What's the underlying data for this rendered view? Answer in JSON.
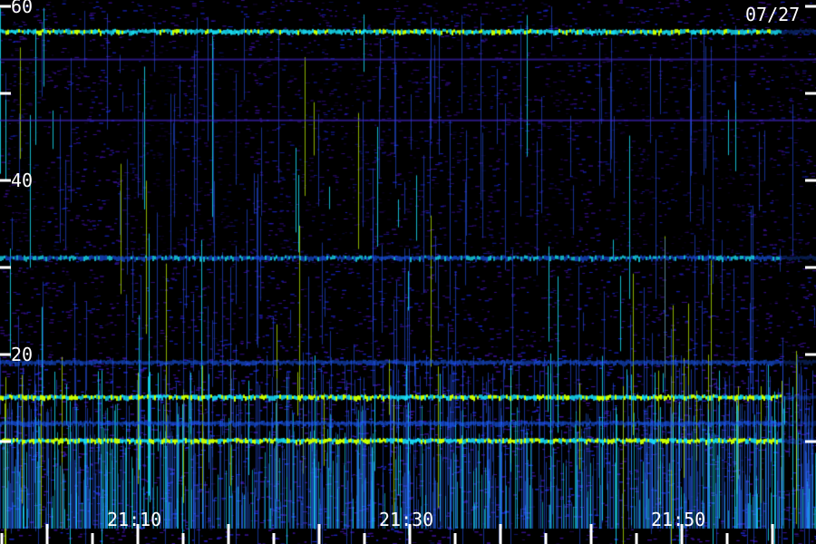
{
  "chart_data": {
    "type": "heatmap",
    "date_label": "07/27",
    "ylim": [
      0,
      60
    ],
    "y_tick_labels": [
      "60",
      "40",
      "20"
    ],
    "y_ticks": [
      60,
      50,
      40,
      30,
      20,
      10
    ],
    "x_tick_labels": [
      "21:10",
      "21:30",
      "21:50"
    ],
    "colors": {
      "background": "#000000",
      "low": "#2a0a78",
      "mid": "#1a5cff",
      "high": "#18e8ff",
      "peak": "#c8ff00"
    },
    "bands": [
      {
        "freq": 57,
        "intensity": 0.85
      },
      {
        "freq": 31,
        "intensity": 0.6
      },
      {
        "freq": 19,
        "intensity": 0.45
      },
      {
        "freq": 15,
        "intensity": 0.9
      },
      {
        "freq": 12,
        "intensity": 0.5
      },
      {
        "freq": 10,
        "intensity": 0.95
      }
    ]
  }
}
